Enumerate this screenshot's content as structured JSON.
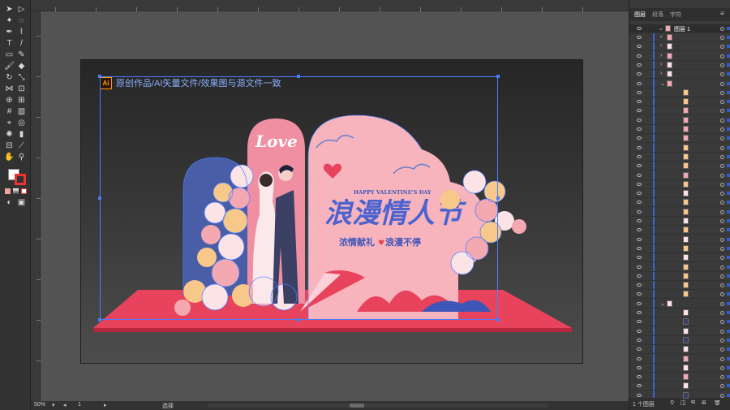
{
  "panel": {
    "tabs": [
      "图层",
      "段落",
      "字符"
    ],
    "top_layer_name": "图层 1",
    "footer_text": "1 个图层"
  },
  "canvas": {
    "caption": "原创作品/AI矢量文件/效果图与源文件一致",
    "badge": "Ai"
  },
  "artwork": {
    "love_text": "Love",
    "happy_text": "HAPPY VALENTINE'S DAY",
    "title": "浪漫情人节",
    "subtitle": "浓情献礼",
    "subtitle2": "浪漫不停",
    "heart_char": "♥"
  },
  "status": {
    "zoom": "50%",
    "page": "1",
    "mode": "选择"
  },
  "colors": {
    "accent_blue": "#4a7dff",
    "pink": "#f5a3b0",
    "stage_red": "#e8435c"
  }
}
